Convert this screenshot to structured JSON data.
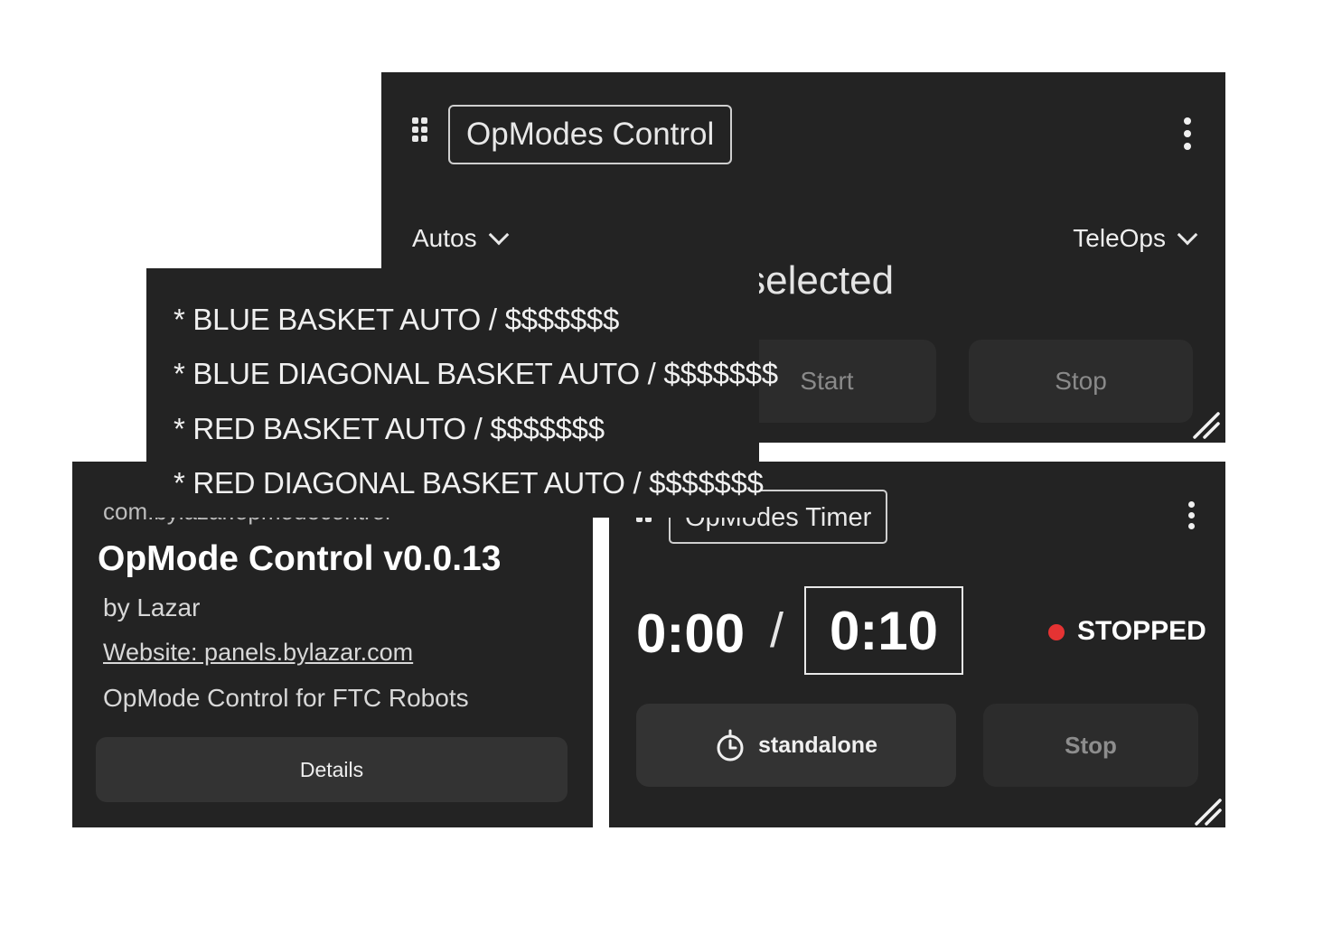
{
  "control_panel": {
    "title": "OpModes Control",
    "autos_label": "Autos",
    "teleops_label": "TeleOps",
    "selection_status": "ng selected",
    "start_label": "Start",
    "stop_label": "Stop"
  },
  "autos_menu": {
    "items": [
      "* BLUE BASKET AUTO / $$$$$$$",
      "* BLUE DIAGONAL BASKET AUTO / $$$$$$$",
      "* RED BASKET AUTO / $$$$$$$",
      "* RED DIAGONAL BASKET AUTO / $$$$$$$"
    ]
  },
  "plugin_panel": {
    "id_text": "com.bylazar.opmodecontrol",
    "name": "OpMode Control v0.0.13",
    "author": "by Lazar",
    "website": "Website: panels.bylazar.com",
    "description": "OpMode Control for FTC Robots",
    "details_label": "Details"
  },
  "timer_panel": {
    "title": "OpModes Timer",
    "elapsed": "0:00",
    "separator": "/",
    "limit": "0:10",
    "status": "STOPPED",
    "status_color": "#e53333",
    "mode_icon": "timer-icon",
    "mode_label": "standalone",
    "stop_label": "Stop"
  },
  "colors": {
    "panel_bg": "#232323",
    "button_bg": "#333333",
    "muted_button_bg": "#2c2c2c"
  }
}
